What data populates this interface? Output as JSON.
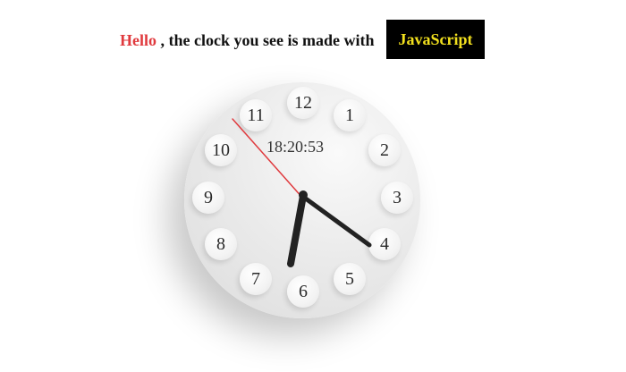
{
  "header": {
    "hello": "Hello",
    "rest": " , the clock you see is made with",
    "badge": "JavaScript"
  },
  "clock": {
    "digital_time": "18:20:53",
    "numbers": [
      "12",
      "1",
      "2",
      "3",
      "4",
      "5",
      "6",
      "7",
      "8",
      "9",
      "10",
      "11"
    ],
    "time": {
      "hours": 18,
      "minutes": 20,
      "seconds": 53
    }
  },
  "colors": {
    "hello": "#e03a3e",
    "badge_bg": "#000000",
    "badge_text": "#f2e01e",
    "second_hand": "#e03a3e",
    "hands": "#222222"
  }
}
